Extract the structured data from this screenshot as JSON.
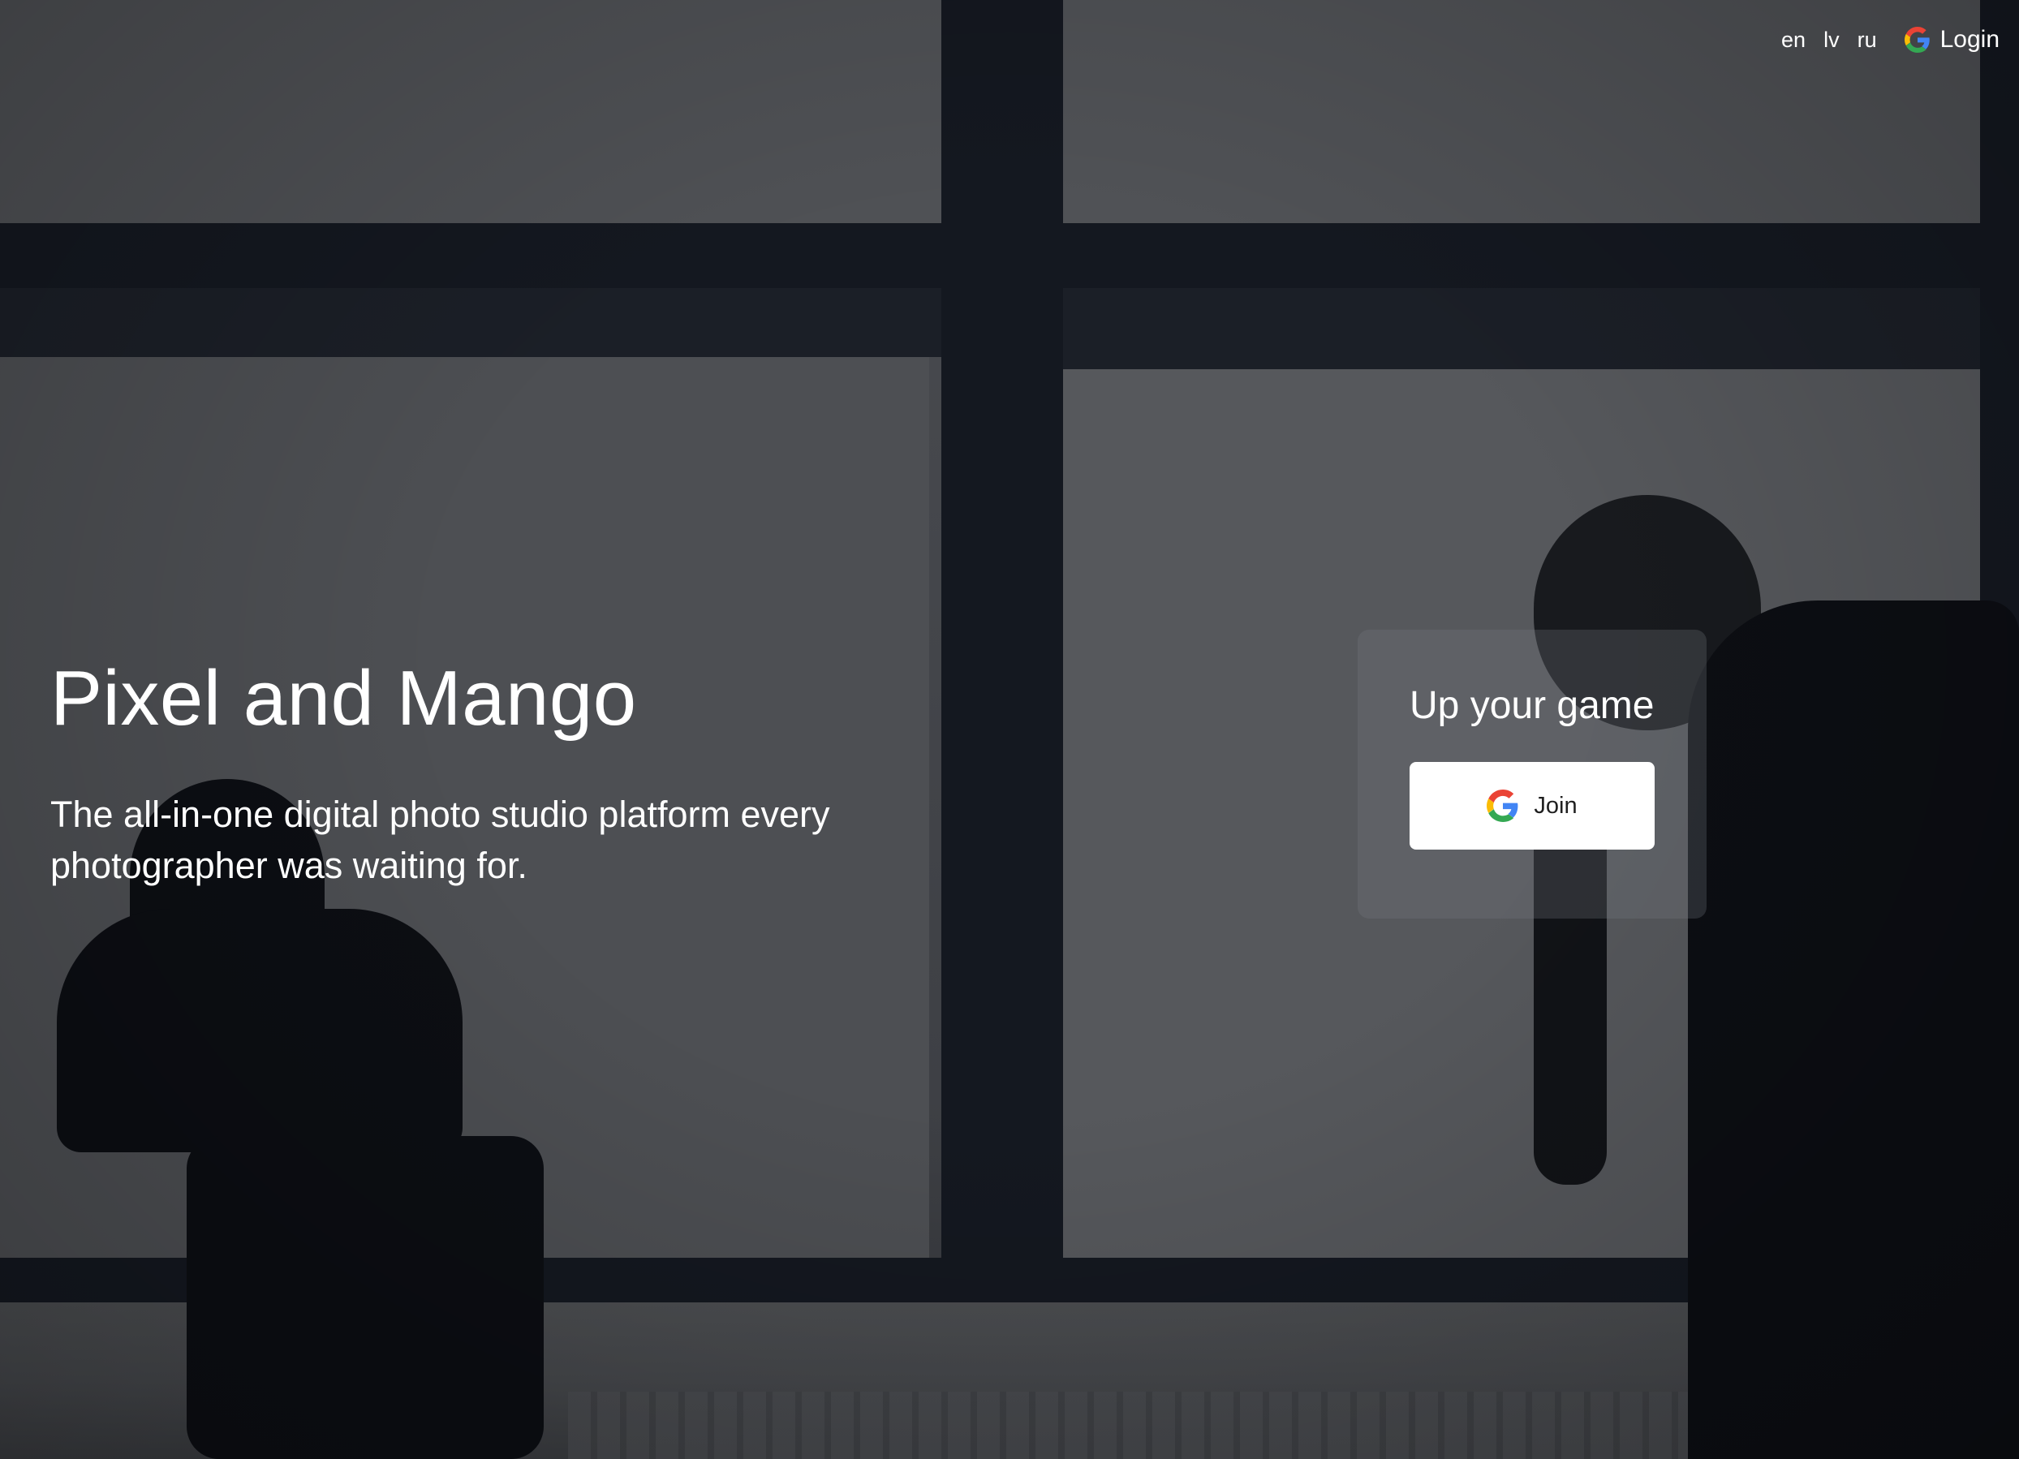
{
  "nav": {
    "languages": [
      "en",
      "lv",
      "ru"
    ],
    "login_label": "Login"
  },
  "hero": {
    "title": "Pixel and Mango",
    "subtitle": "The all-in-one digital photo studio platform every photographer was waiting for."
  },
  "card": {
    "title": "Up your game",
    "join_label": "Join"
  },
  "icons": {
    "login": "google-icon",
    "join": "google-icon"
  },
  "colors": {
    "overlay_text": "#ffffff",
    "button_bg": "#ffffff",
    "button_text": "#1f1f1f",
    "google_blue": "#4285F4",
    "google_red": "#EA4335",
    "google_yellow": "#FBBC05",
    "google_green": "#34A853"
  }
}
